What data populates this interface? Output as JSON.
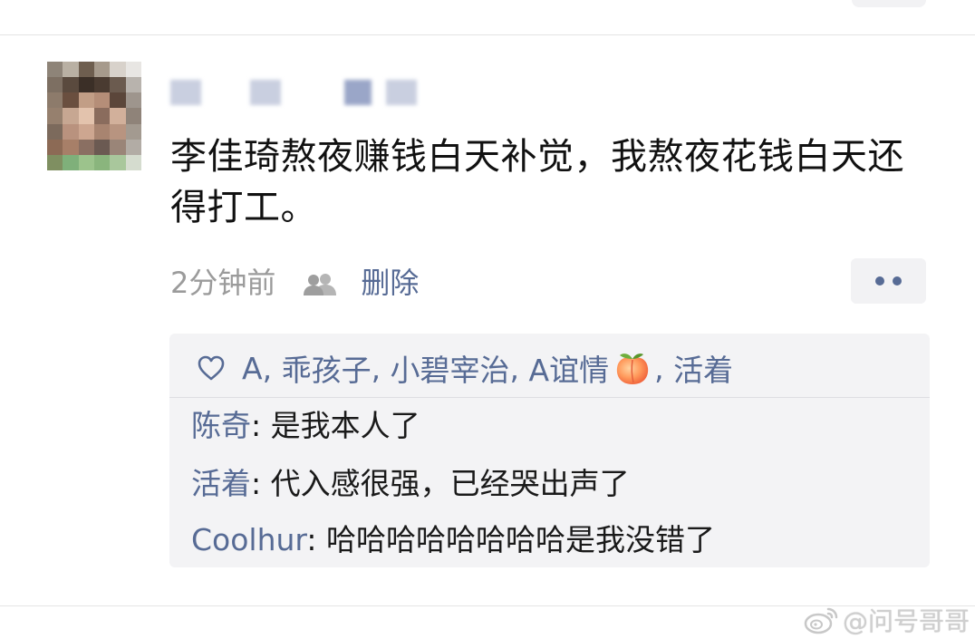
{
  "post": {
    "text": "李佳琦熬夜赚钱白天补觉，我熬夜花钱白天还得打工。",
    "time": "2分钟前",
    "delete_label": "删除",
    "visibility_icon": "friends-icon",
    "more_icon": "more-dots-icon"
  },
  "likes": {
    "icon": "heart-icon",
    "names": [
      "A",
      "乖孩子",
      "小碧宰治",
      "A谊情",
      "活着"
    ],
    "separator": ", ",
    "emoji_after_4": "peach-emoji"
  },
  "comments": [
    {
      "author": "陈奇",
      "text": "是我本人了"
    },
    {
      "author": "活着",
      "text": "代入感很强，已经哭出声了"
    },
    {
      "author": "Coolhur",
      "text": "哈哈哈哈哈哈哈哈是我没错了"
    }
  ],
  "watermark": {
    "text": "@问号哥哥",
    "icon": "weibo-logo-icon"
  },
  "colors": {
    "link_blue": "#576b95",
    "text_dark": "#111111",
    "time_grey": "#9b9b9b",
    "panel_bg": "#f3f3f5"
  }
}
